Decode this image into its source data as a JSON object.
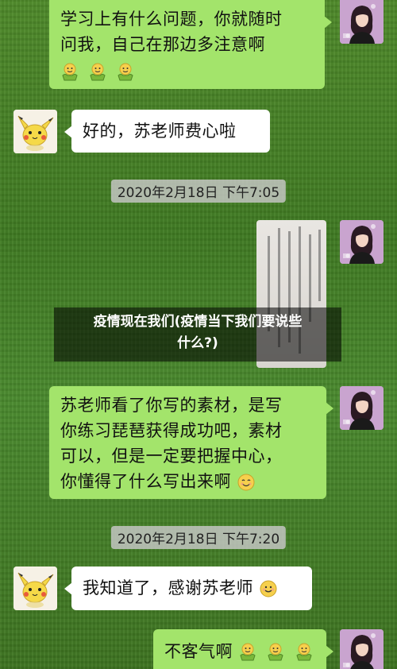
{
  "messages": {
    "m1_line1": "学习上有什么问题，你就随时",
    "m1_line2": "问我，自己在那边多注意啊",
    "m2": "好的，苏老师费心啦",
    "m3_line1": "苏老师看了你写的素材，是写",
    "m3_line2": "你练习琵琶获得成功吧，素材",
    "m3_line3": "可以，但是一定要把握中心，",
    "m3_line4": "你懂得了什么写出来啊",
    "m4": "我知道了，感谢苏老师",
    "m5": "不客气啊"
  },
  "timestamps": {
    "t1": "2020年2月18日 下午7:05",
    "t2": "2020年2月18日 下午7:20"
  },
  "overlay": {
    "line1": "疫情现在我们(疫情当下我们要说些",
    "line2": "什么?)"
  },
  "icons": {
    "teacher_avatar": "woman-portrait-avatar",
    "student_avatar": "pikachu-avatar",
    "emoji_strong": "strong-emoji",
    "emoji_smile": "smile-emoji",
    "emoji_blush": "blush-emoji"
  },
  "colors": {
    "sent_bubble": "#a3e46b",
    "received_bubble": "#ffffff",
    "teacher_avatar_bg": "#c9a4cf"
  }
}
